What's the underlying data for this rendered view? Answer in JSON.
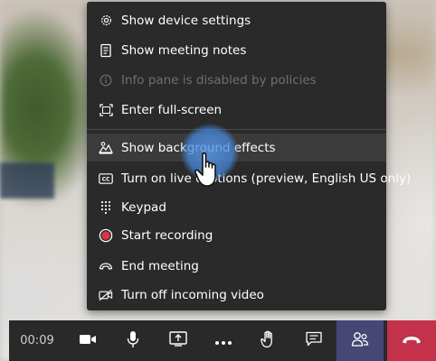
{
  "menu": {
    "items": [
      {
        "label": "Show device settings",
        "icon": "gear-icon"
      },
      {
        "label": "Show meeting notes",
        "icon": "notes-icon"
      },
      {
        "label": "Info pane is disabled by policies",
        "icon": "info-icon",
        "disabled": true
      },
      {
        "label": "Enter full-screen",
        "icon": "fullscreen-icon"
      },
      {
        "label": "Show background effects",
        "icon": "background-effects-icon",
        "hovered": true
      },
      {
        "label": "Turn on live captions (preview, English US only)",
        "icon": "captions-icon"
      },
      {
        "label": "Keypad",
        "icon": "keypad-icon"
      },
      {
        "label": "Start recording",
        "icon": "record-icon"
      },
      {
        "label": "End meeting",
        "icon": "end-meeting-icon"
      },
      {
        "label": "Turn off incoming video",
        "icon": "video-off-icon"
      }
    ]
  },
  "toolbar": {
    "call_duration": "00:09",
    "buttons": [
      "camera-icon",
      "microphone-icon",
      "share-screen-icon",
      "more-options-icon",
      "raise-hand-icon",
      "chat-icon",
      "participants-icon",
      "hang-up-icon"
    ]
  },
  "colors": {
    "menu_bg": "#2a2a2a",
    "hover_bg": "#3b3b3b",
    "record_red": "#e0324a",
    "hangup_red": "#c4314b",
    "participants_purple": "#464775"
  }
}
